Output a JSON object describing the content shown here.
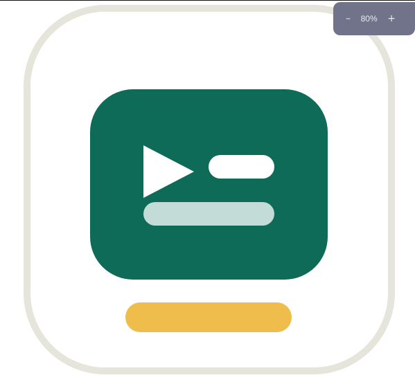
{
  "illustration": {
    "name": "terminal-app-icon",
    "colors": {
      "frame_border": "#e6e5dc",
      "screen": "#0e6b57",
      "play_triangle": "#ffffff",
      "pill_short": "#ffffff",
      "pill_long": "#c3dcd8",
      "base_bar": "#efbd4c"
    }
  },
  "zoom_control": {
    "decrease_label": "–",
    "level": "80%",
    "increase_label": "+",
    "background": "#71738a"
  }
}
